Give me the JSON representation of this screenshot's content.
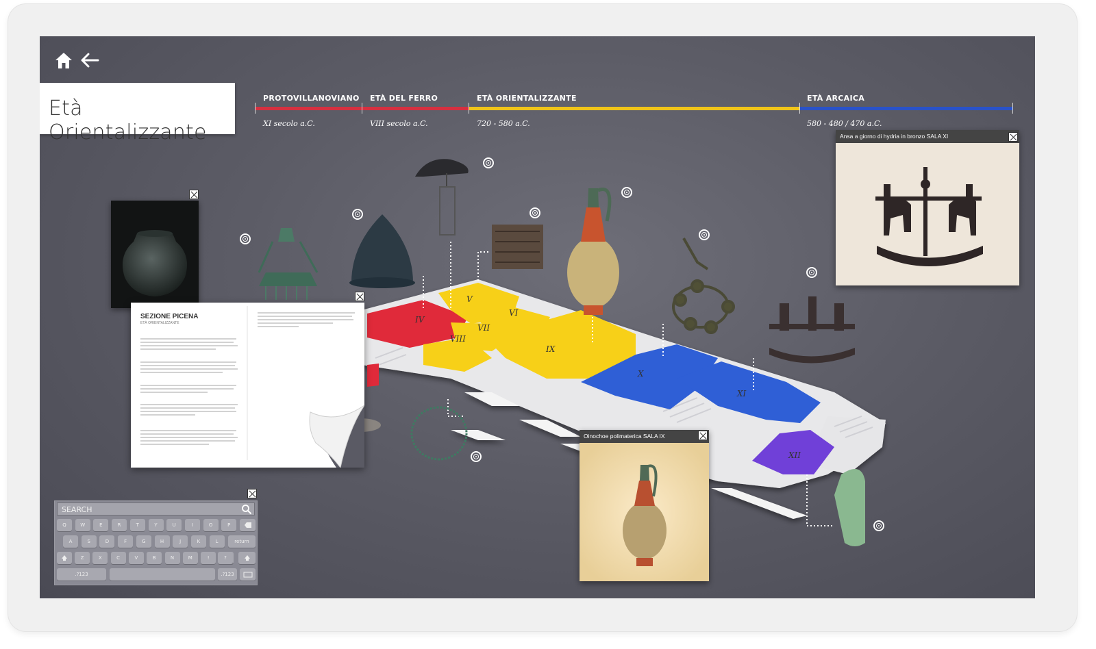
{
  "header": {
    "title": "Età Orientalizzante"
  },
  "nav": {
    "home_icon": "home-icon",
    "back_icon": "arrow-left-icon"
  },
  "timeline": {
    "periods": [
      {
        "label": "PROTOVILLANOVIANO",
        "date": "XI secolo a.C.",
        "color": "#d63040"
      },
      {
        "label": "ETÀ DEL FERRO",
        "date": "VIII secolo a.C.",
        "color": "#d63040"
      },
      {
        "label": "ETÀ ORIENTALIZZANTE",
        "date": "720 - 580 a.C.",
        "color": "#f0c419"
      },
      {
        "label": "ETÀ ARCAICA",
        "date": "580 - 480 / 470 a.C.",
        "color": "#2a52c8"
      }
    ]
  },
  "map": {
    "rooms": [
      "IV",
      "V",
      "VI",
      "VII",
      "VIII",
      "IX",
      "X",
      "XI",
      "XII"
    ],
    "colors": {
      "red": "#e02a3a",
      "yellow": "#f7d018",
      "blue": "#2f5fd6",
      "purple": "#7040d8"
    }
  },
  "popups": {
    "hydria": {
      "caption": "Ansa a giorno di hydria in bronzo SALA XI"
    },
    "oinochoe": {
      "caption": "Oinochoe polimaterica SALA IX"
    }
  },
  "doc": {
    "title": "SEZIONE PICENA",
    "subtitle": "ETÀ ORIENTALIZZANTE"
  },
  "keyboard": {
    "search_label": "SEARCH",
    "row1": [
      "Q",
      "W",
      "E",
      "R",
      "T",
      "Y",
      "U",
      "I",
      "O",
      "P"
    ],
    "row2": [
      "A",
      "S",
      "D",
      "F",
      "G",
      "H",
      "J",
      "K",
      "L"
    ],
    "row2_return": "return",
    "row3": [
      "Z",
      "X",
      "C",
      "V",
      "B",
      "N",
      "M",
      "!",
      ","
    ],
    "row3_extra": "?",
    "numkey": ".?123"
  }
}
